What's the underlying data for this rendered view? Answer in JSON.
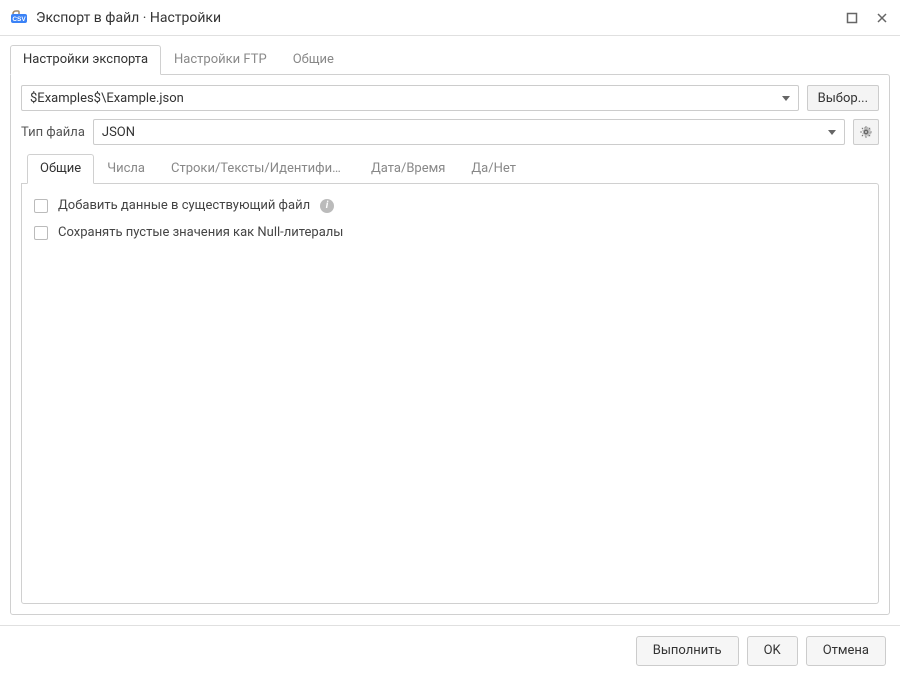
{
  "window": {
    "title": "Экспорт в файл · Настройки"
  },
  "outerTabs": {
    "export": "Настройки экспорта",
    "ftp": "Настройки FTP",
    "general": "Общие"
  },
  "path": {
    "value": "$Examples$\\Example.json",
    "browse": "Выбор..."
  },
  "fileType": {
    "label": "Тип файла",
    "value": "JSON"
  },
  "innerTabs": {
    "general": "Общие",
    "numbers": "Числа",
    "strings": "Строки/Тексты/Идентифик...",
    "datetime": "Дата/Время",
    "bool": "Да/Нет"
  },
  "options": {
    "append": "Добавить данные в существующий файл",
    "nullLiterals": "Сохранять пустые значения как Null-литералы"
  },
  "footer": {
    "run": "Выполнить",
    "ok": "OK",
    "cancel": "Отмена"
  }
}
